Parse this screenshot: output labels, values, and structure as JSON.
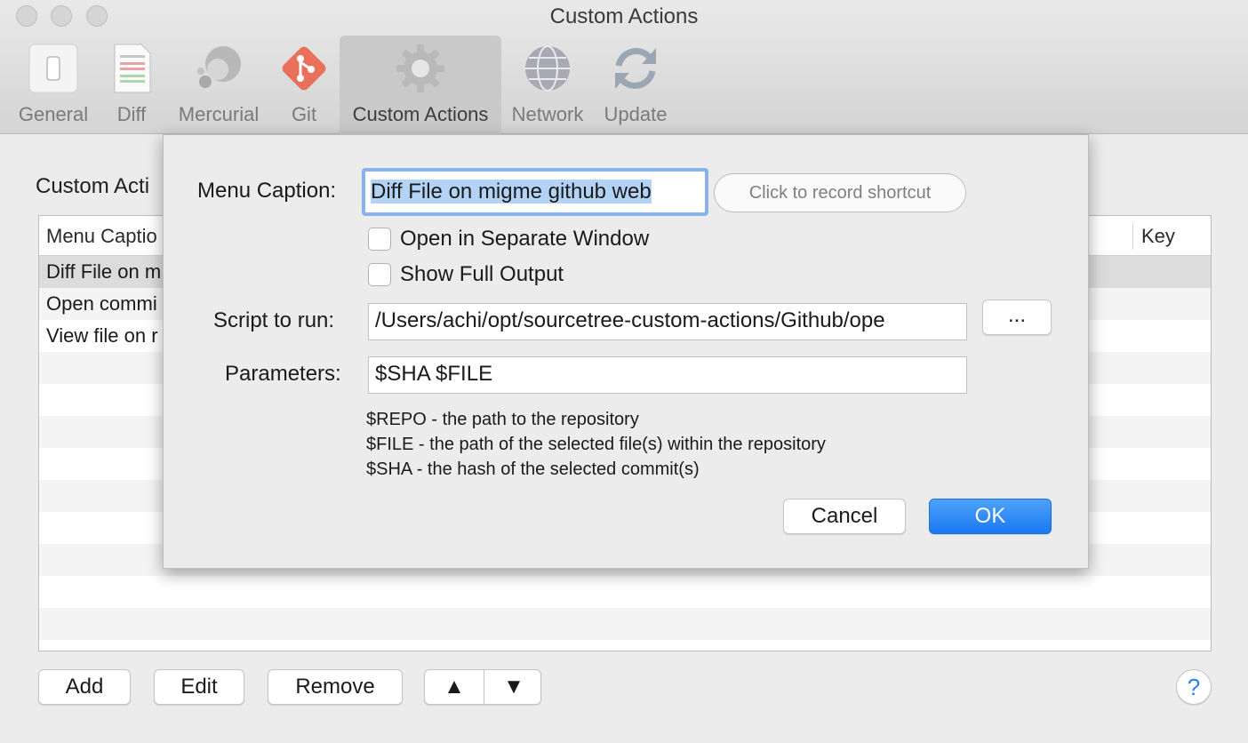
{
  "window": {
    "title": "Custom Actions"
  },
  "toolbar": {
    "tabs": [
      {
        "label": "General",
        "icon": "switch-icon"
      },
      {
        "label": "Diff",
        "icon": "diff-document-icon"
      },
      {
        "label": "Mercurial",
        "icon": "mercurial-icon"
      },
      {
        "label": "Git",
        "icon": "git-icon"
      },
      {
        "label": "Custom Actions",
        "icon": "gear-icon",
        "active": true
      },
      {
        "label": "Network",
        "icon": "globe-icon"
      },
      {
        "label": "Update",
        "icon": "refresh-icon"
      }
    ]
  },
  "main": {
    "section_title": "Custom Acti",
    "table": {
      "columns": [
        "Menu Captio",
        "Key"
      ],
      "rows": [
        "Diff File on m",
        "Open commi",
        "View file on r"
      ]
    },
    "buttons": {
      "add": "Add",
      "edit": "Edit",
      "remove": "Remove",
      "up": "▲",
      "down": "▼",
      "help": "?"
    }
  },
  "sheet": {
    "menu_caption_label": "Menu Caption:",
    "menu_caption_value": "Diff File on migme github web",
    "shortcut_placeholder": "Click to record shortcut",
    "open_separate_window": {
      "label": "Open in Separate Window",
      "checked": false
    },
    "show_full_output": {
      "label": "Show Full Output",
      "checked": false
    },
    "script_label": "Script to run:",
    "script_value": "/Users/achi/opt/sourcetree-custom-actions/Github/ope",
    "browse_label": "...",
    "params_label": "Parameters:",
    "params_value": "$SHA $FILE",
    "help_lines": [
      "$REPO - the path to the repository",
      "$FILE - the path of the selected file(s) within the repository",
      "$SHA - the hash of the selected commit(s)"
    ],
    "cancel_label": "Cancel",
    "ok_label": "OK"
  },
  "colors": {
    "accent": "#1a78f2",
    "focus_ring": "#86b3ec",
    "selection": "#b3d3f6"
  }
}
